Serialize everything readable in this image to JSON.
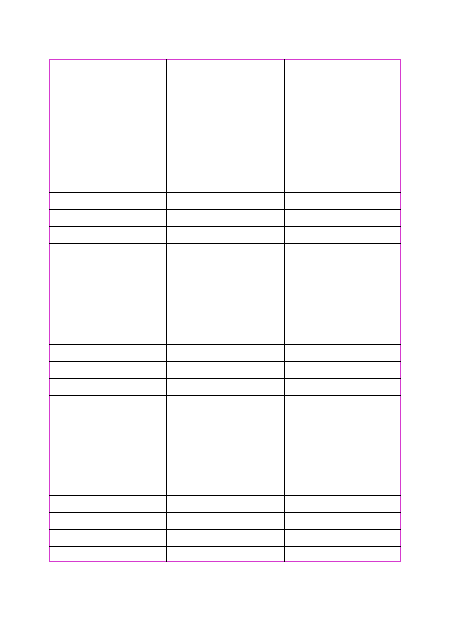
{
  "sheet": {
    "frame_color": "#d63ccf",
    "line_color": "#000000",
    "columns": 3,
    "rows": [
      {
        "kind": "tall",
        "cells": [
          "",
          "",
          ""
        ]
      },
      {
        "kind": "short",
        "cells": [
          "",
          "",
          ""
        ]
      },
      {
        "kind": "short",
        "cells": [
          "",
          "",
          ""
        ]
      },
      {
        "kind": "tall",
        "cells": [
          "",
          "",
          ""
        ]
      },
      {
        "kind": "short",
        "cells": [
          "",
          "",
          ""
        ]
      },
      {
        "kind": "short",
        "cells": [
          "",
          "",
          ""
        ]
      },
      {
        "kind": "tall",
        "cells": [
          "",
          "",
          ""
        ]
      },
      {
        "kind": "short",
        "cells": [
          "",
          "",
          ""
        ]
      },
      {
        "kind": "short",
        "cells": [
          "",
          "",
          ""
        ]
      },
      {
        "kind": "short",
        "cells": [
          "",
          "",
          ""
        ]
      }
    ]
  }
}
